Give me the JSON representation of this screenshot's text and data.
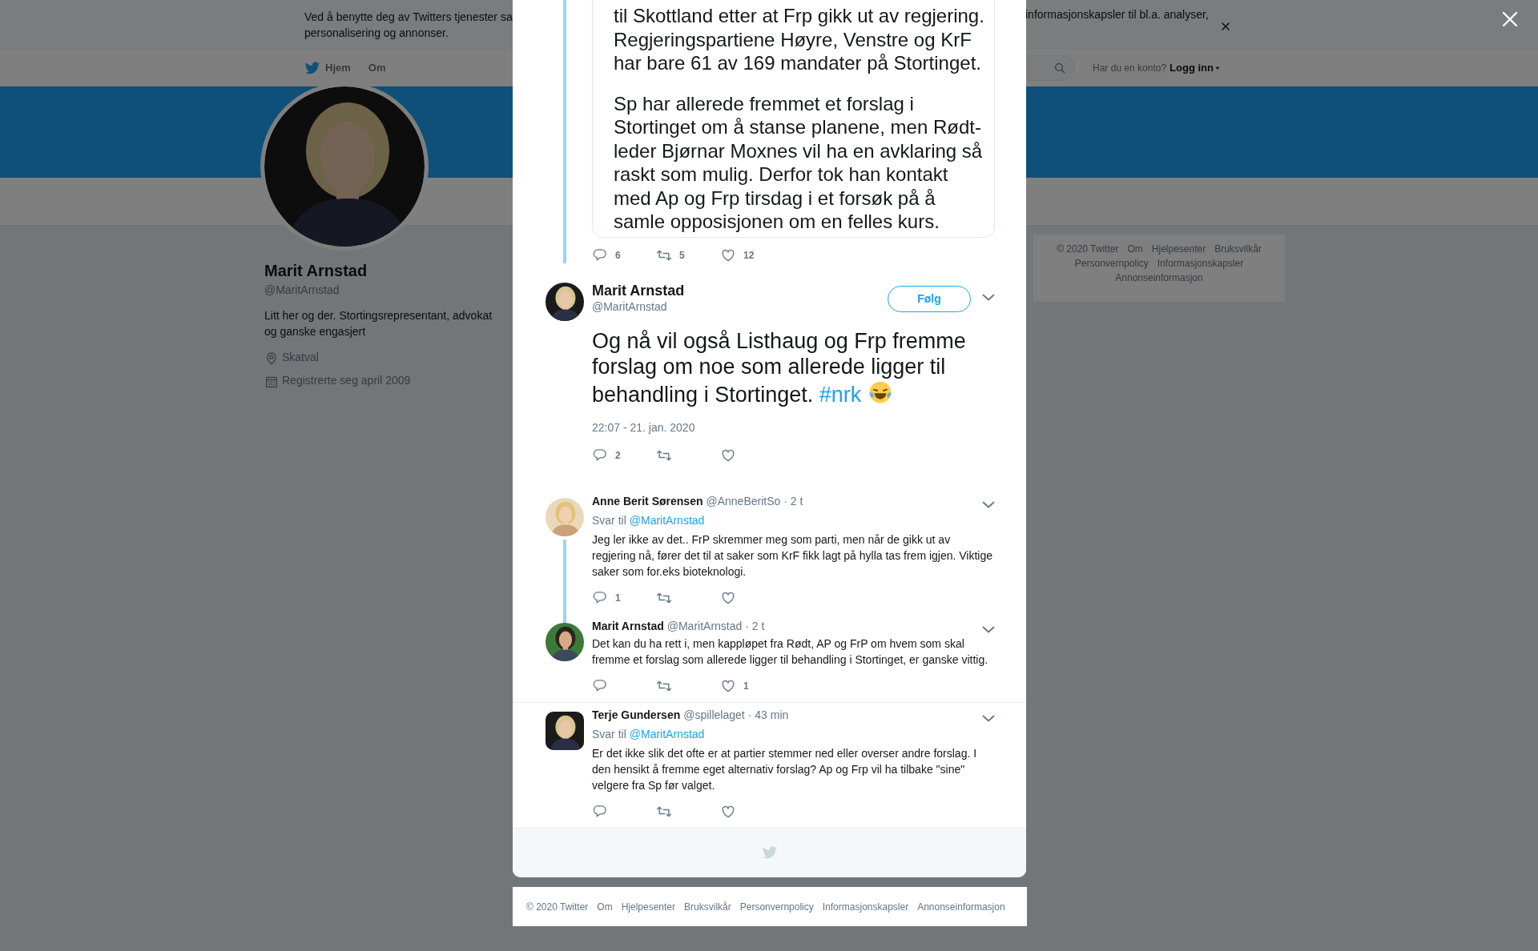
{
  "cookie_banner": {
    "lines_start": [
      "Ved å benytte deg av Twitters tjenester sa",
      "personalisering og annonser."
    ],
    "text_end": "informasjonskapsler til bl.a. analyser,"
  },
  "nav": {
    "items": [
      "Hjem",
      "Om"
    ],
    "account_prompt": "Har du en konto?",
    "login": "Logg inn"
  },
  "profile": {
    "name": "Marit Arnstad",
    "handle": "@MaritArnstad",
    "bio": "Litt her og der. Stortingsrepresentant, advokat og ganske engasjert",
    "location": "Skatval",
    "joined": "Registrerte seg april 2009"
  },
  "side_footer": {
    "links": [
      "© 2020 Twitter",
      "Om",
      "Hjelpesenter",
      "Bruksvilkår",
      "Personvernpolicy",
      "Informasjonskapsler",
      "Annonseinformasjon"
    ]
  },
  "modal": {
    "parent_tweet": {
      "card_paragraphs": [
        "til Skottland etter at Frp gikk ut av regjering.\nRegjeringspartiene Høyre, Venstre og KrF\nhar bare 61 av 169 mandater på Stortinget.",
        "Sp har allerede fremmet et forslag i\nStortinget om å stanse planene, men Rødt-\nleder Bjørnar Moxnes vil ha en avklaring så\nraskt som mulig. Derfor tok han kontakt\nmed Ap og Frp tirsdag i et forsøk på å\nsamle opposisjonen om en felles kurs."
      ],
      "replies": "6",
      "retweets": "5",
      "likes": "12"
    },
    "tweet": {
      "name": "Marit Arnstad",
      "handle": "@MaritArnstad",
      "follow": "Følg",
      "text": "Og nå vil også Listhaug og Frp fremme forslag om noe som allerede ligger til behandling i Stortinget.",
      "hashtag": "#nrk",
      "timestamp": "22:07 - 21. jan. 2020",
      "replies": "2"
    },
    "replies": [
      {
        "name": "Anne Berit Sørensen",
        "handle": "@AnneBeritSo",
        "time": "· 2 t",
        "reply_label": "Svar til",
        "reply_to": "@MaritArnstad",
        "text": "Jeg ler ikke av det.. FrP skremmer meg som parti, men når de gikk ut av regjering nå, fører det til at saker som KrF fikk lagt på hylla tas frem igjen. Viktige saker som for.eks bioteknologi.",
        "replies": "1",
        "threaded": true
      },
      {
        "name": "Marit Arnstad",
        "handle": "@MaritArnstad",
        "time": "· 2 t",
        "text": "Det kan du ha rett i, men kappløpet fra Rødt, AP og FrP om hvem som skal fremme et forslag som allerede ligger til behandling i Stortinget, er ganske vittig.",
        "likes": "1",
        "threaded": false
      },
      {
        "name": "Terje Gundersen",
        "handle": "@spillelaget",
        "time": "· 43 min",
        "reply_label": "Svar til",
        "reply_to": "@MaritArnstad",
        "text": "Er det ikke slik det ofte er at partier stemmer ned eller overser andre forslag. I den hensikt å fremme eget alternativ forslag? Ap og Frp vil ha tilbake \"sine\" velgere fra Sp før valget.",
        "threaded": false
      }
    ]
  },
  "footer": {
    "links": [
      "© 2020 Twitter",
      "Om",
      "Hjelpesenter",
      "Bruksvilkår",
      "Personvernpolicy",
      "Informasjonskapsler",
      "Annonseinformasjon"
    ]
  }
}
